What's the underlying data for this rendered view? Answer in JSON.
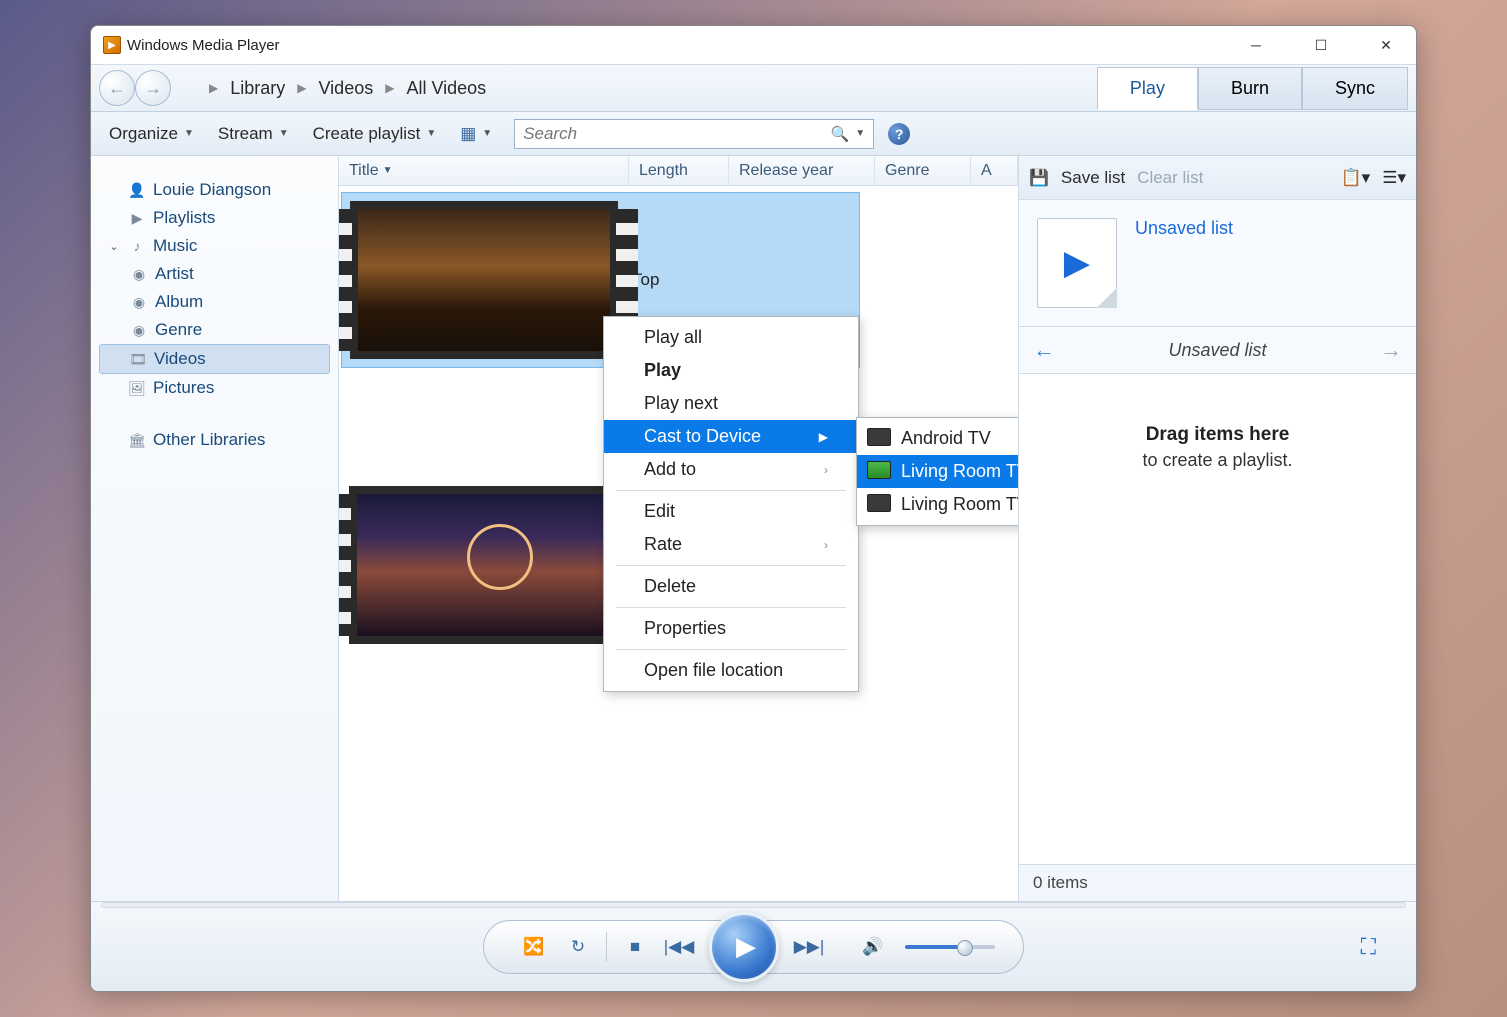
{
  "app_title": "Windows Media Player",
  "breadcrumb": [
    "Library",
    "Videos",
    "All Videos"
  ],
  "nav_tabs": {
    "play": "Play",
    "burn": "Burn",
    "sync": "Sync"
  },
  "toolbar": {
    "organize": "Organize",
    "stream": "Stream",
    "create_playlist": "Create playlist",
    "search_placeholder": "Search"
  },
  "sidebar": {
    "user": "Louie Diangson",
    "playlists": "Playlists",
    "music": "Music",
    "artist": "Artist",
    "album": "Album",
    "genre": "Genre",
    "videos": "Videos",
    "pictures": "Pictures",
    "other": "Other Libraries"
  },
  "columns": {
    "title": "Title",
    "length": "Length",
    "release": "Release year",
    "genre": "Genre",
    "a": "A"
  },
  "videos": {
    "item1_label": "Top"
  },
  "context_menu": {
    "play_all": "Play all",
    "play": "Play",
    "play_next": "Play next",
    "cast": "Cast to Device",
    "add_to": "Add to",
    "edit": "Edit",
    "rate": "Rate",
    "delete": "Delete",
    "properties": "Properties",
    "open_loc": "Open file location"
  },
  "cast_submenu": {
    "android": "Android TV",
    "living1": "Living Room TV",
    "living2": "Living Room TV"
  },
  "right_panel": {
    "save_list": "Save list",
    "clear_list": "Clear list",
    "unsaved_link": "Unsaved list",
    "unsaved_title": "Unsaved list",
    "drag_title": "Drag items here",
    "drag_sub": "to create a playlist.",
    "item_count": "0 items"
  }
}
